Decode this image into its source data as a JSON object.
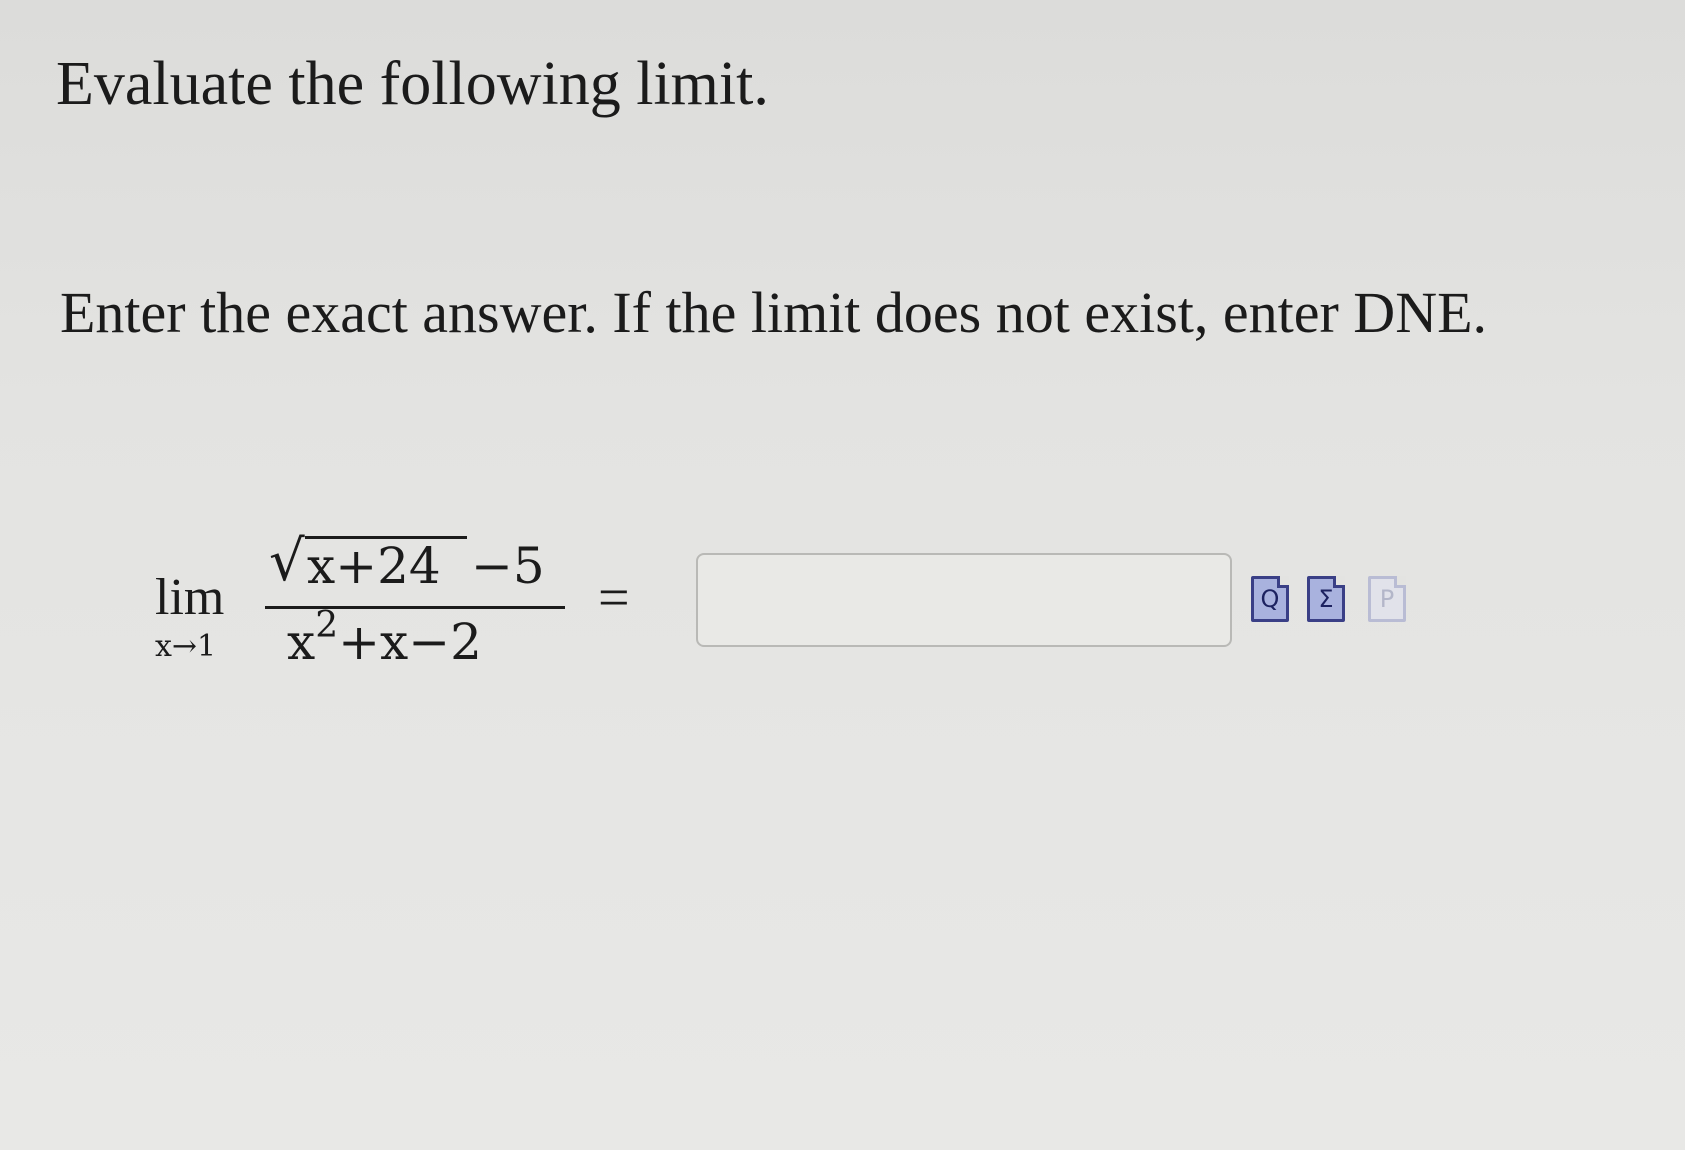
{
  "question": {
    "title": "Evaluate the following limit.",
    "instruction": "Enter the exact answer. If the limit does not exist, enter DNE."
  },
  "expression": {
    "lim": "lim",
    "lim_subscript": "x→1",
    "radicand": "x+24",
    "numerator_tail": "−5",
    "denominator_base": "x",
    "denominator_exponent": "2",
    "denominator_tail": "+x−2",
    "equals": "="
  },
  "answer": {
    "value": "",
    "placeholder": ""
  },
  "tools": {
    "preview_icon": "preview-icon",
    "preview_glyph": "Q",
    "equation_icon": "equation-editor-icon",
    "equation_glyph": "Σ",
    "palette_icon": "palette-icon",
    "palette_glyph": "P"
  }
}
